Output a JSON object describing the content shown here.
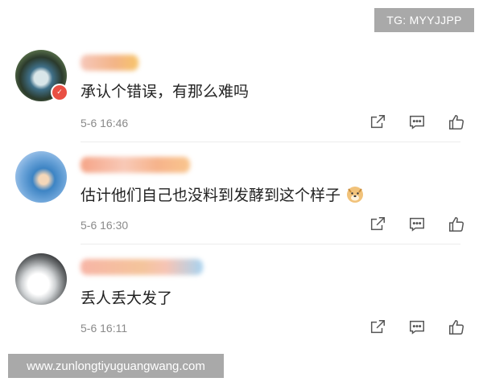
{
  "watermark_top": "TG: MYYJJPP",
  "watermark_bottom": "www.zunlongtiyuguangwang.com",
  "comments": [
    {
      "text": "承认个错误，有那么难吗",
      "time": "5-6 16:46"
    },
    {
      "text": "估计他们自己也没料到发酵到这个样子",
      "time": "5-6 16:30",
      "emoji": "doge-emoji"
    },
    {
      "text": "丢人丢大发了",
      "time": "5-6 16:11"
    }
  ],
  "icons": {
    "share": "share-icon",
    "reply": "comment-icon",
    "like": "thumbs-up-icon"
  }
}
